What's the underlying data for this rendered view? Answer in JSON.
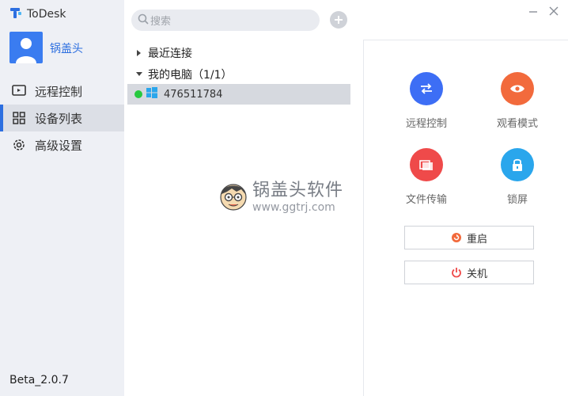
{
  "app": {
    "title": "ToDesk",
    "version": "Beta_2.0.7"
  },
  "user": {
    "name": "锅盖头"
  },
  "nav": {
    "items": [
      {
        "label": "远程控制",
        "icon": "remote-control-icon"
      },
      {
        "label": "设备列表",
        "icon": "grid-icon",
        "active": true
      },
      {
        "label": "高级设置",
        "icon": "gear-icon"
      }
    ]
  },
  "search": {
    "placeholder": "搜索"
  },
  "tree": {
    "recent_label": "最近连接",
    "my_computers_label": "我的电脑（1/1）",
    "devices": [
      {
        "id": "476511784",
        "status": "online",
        "os": "windows"
      }
    ]
  },
  "actions": {
    "remote_control": {
      "label": "远程控制",
      "color": "#3d6ef5"
    },
    "view_mode": {
      "label": "观看模式",
      "color": "#f26a3c"
    },
    "file_transfer": {
      "label": "文件传输",
      "color": "#ef4a4a"
    },
    "lock_screen": {
      "label": "锁屏",
      "color": "#2aa6ec"
    }
  },
  "buttons": {
    "restart": "重启",
    "shutdown": "关机"
  },
  "watermark": {
    "main": "锅盖头软件",
    "sub": "www.ggtrj.com"
  },
  "colors": {
    "accent": "#2d6fe0",
    "online": "#27c93f",
    "sidebar_bg": "#eef0f5"
  }
}
